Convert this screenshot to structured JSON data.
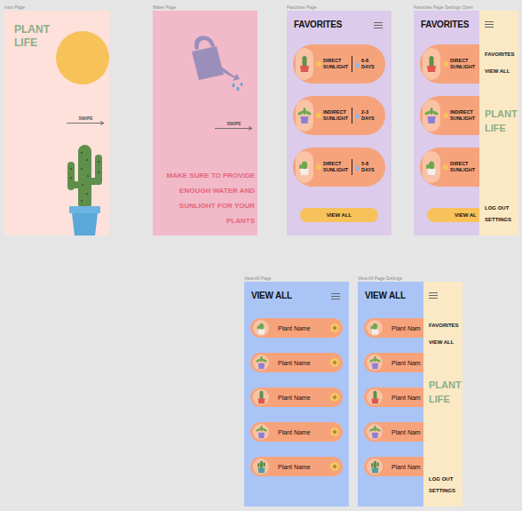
{
  "frames": [
    {
      "kind": "intro",
      "label": "Intro Page",
      "title": "PLANT LIFE",
      "swipe": "SWIPE"
    },
    {
      "kind": "water",
      "label": "Water Page",
      "swipe": "SWIPE",
      "message": "MAKE SURE TO PROVIDE ENOUGH WATER AND SUNLIGHT FOR YOUR PLANTS"
    },
    {
      "kind": "favorites",
      "label": "Favorites Page",
      "title": "FAVORITES",
      "menu_open": false,
      "plants": [
        {
          "sunlight": "DIRECT SUNLIGHT",
          "water": "6-8 DAYS"
        },
        {
          "sunlight": "INDIRECT SUNLIGHT",
          "water": "2-3 DAYS"
        },
        {
          "sunlight": "DIRECT SUNLIGHT",
          "water": "5-8 DAYS"
        }
      ],
      "button": "VIEW ALL"
    },
    {
      "kind": "favorites",
      "label": "Favorites Page Settings Open",
      "title": "FAVORITES",
      "menu_open": true,
      "plants": [
        {
          "sunlight": "DIRECT SUNLIGHT"
        },
        {
          "sunlight": "INDIRECT SUNLIGHT"
        },
        {
          "sunlight": "DIRECT SUNLIGHT"
        }
      ],
      "button": "VIEW AL",
      "menu": {
        "items": [
          "FAVORITES",
          "VIEW ALL"
        ],
        "brand": "PLANT LIFE",
        "footer": [
          "LOG OUT",
          "SETTINGS"
        ]
      }
    },
    {
      "kind": "view_all",
      "label": "View All Page",
      "title": "VIEW ALL",
      "menu_open": false,
      "plants": [
        "Plant Name",
        "Plant Name",
        "Plant Name",
        "Plant Name",
        "Plant Name"
      ]
    },
    {
      "kind": "view_all",
      "label": "View All Page Settings",
      "title": "VIEW ALL",
      "menu_open": true,
      "plants": [
        "Plant Nam",
        "Plant Nam",
        "Plant Nam",
        "Plant Nam",
        "Plant Nam"
      ],
      "menu": {
        "items": [
          "FAVORITES",
          "VIEW ALL"
        ],
        "brand": "PLANT LIFE",
        "footer": [
          "LOG OUT",
          "SETTINGS"
        ]
      }
    }
  ]
}
